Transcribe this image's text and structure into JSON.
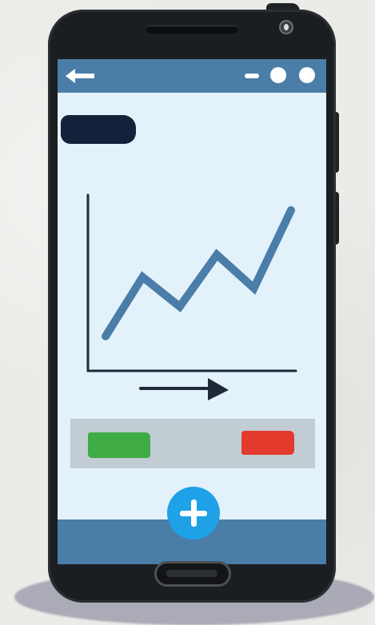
{
  "colors": {
    "background": "#ebebe8",
    "phone_body": "#1b1e21",
    "screen": "#e3f1fb",
    "app_bar": "#4a7da7",
    "title_block": "#13213a",
    "chart_line": "#4a7da7",
    "axis": "#1e2a3a",
    "action_strip": "#c2ccd3",
    "confirm_button": "#3fab45",
    "cancel_button": "#e23a2c",
    "fab": "#1ea1e6"
  },
  "icons": {
    "back": "back-arrow-icon",
    "minimize": "minimize-icon",
    "menu_dot_1": "circle-icon",
    "menu_dot_2": "circle-icon",
    "fab": "plus-icon",
    "axis_arrow": "arrow-right-icon",
    "camera": "camera-icon"
  },
  "chart_data": {
    "type": "line",
    "x": [
      1,
      2,
      3,
      4,
      5,
      6
    ],
    "series": [
      {
        "values": [
          1.0,
          4.2,
          2.6,
          5.4,
          3.6,
          7.8
        ]
      }
    ],
    "xlabel": "",
    "ylabel": "",
    "title": "",
    "grid": false,
    "legend": "none"
  }
}
